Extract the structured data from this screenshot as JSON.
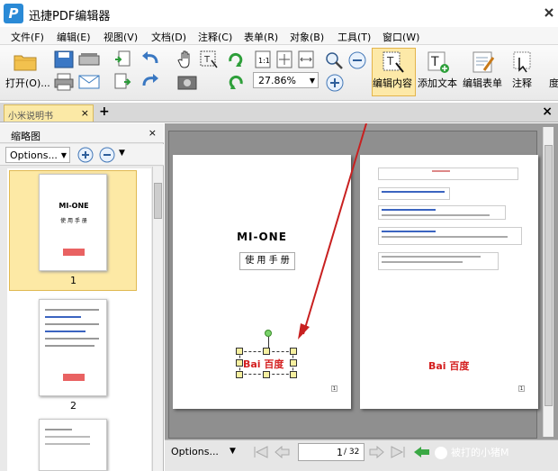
{
  "window": {
    "title": "迅捷PDF编辑器",
    "logo_letter": "P"
  },
  "menu": [
    "文件(F)",
    "编辑(E)",
    "视图(V)",
    "文档(D)",
    "注释(C)",
    "表单(R)",
    "对象(B)",
    "工具(T)",
    "窗口(W)"
  ],
  "toolbar": {
    "open_label": "打开(O)...",
    "zoom_value": "27.86%",
    "edit_content_label": "编辑内容",
    "add_text_label": "添加文本",
    "edit_form_label": "编辑表单",
    "annotate_label": "注释",
    "overflow_label": "度"
  },
  "tab": {
    "label": "小米说明书"
  },
  "sidebar": {
    "title": "缩略图",
    "options_label": "Options...",
    "thumbnails": [
      {
        "number": "1",
        "selected": true,
        "heading": "MI-ONE",
        "subtitle": "使 用 手 册"
      },
      {
        "number": "2",
        "selected": false
      }
    ]
  },
  "page1": {
    "heading": "MI-ONE",
    "subtitle": "使 用 手 册",
    "logo_text": "Bai 百度",
    "page_number": "1"
  },
  "page2": {
    "logo_text": "Bai 百度",
    "page_number": "1"
  },
  "footer": {
    "options_label": "Options...",
    "current_page": "1",
    "total_pages": "/ 32",
    "watermark": "被打的小猪M"
  }
}
